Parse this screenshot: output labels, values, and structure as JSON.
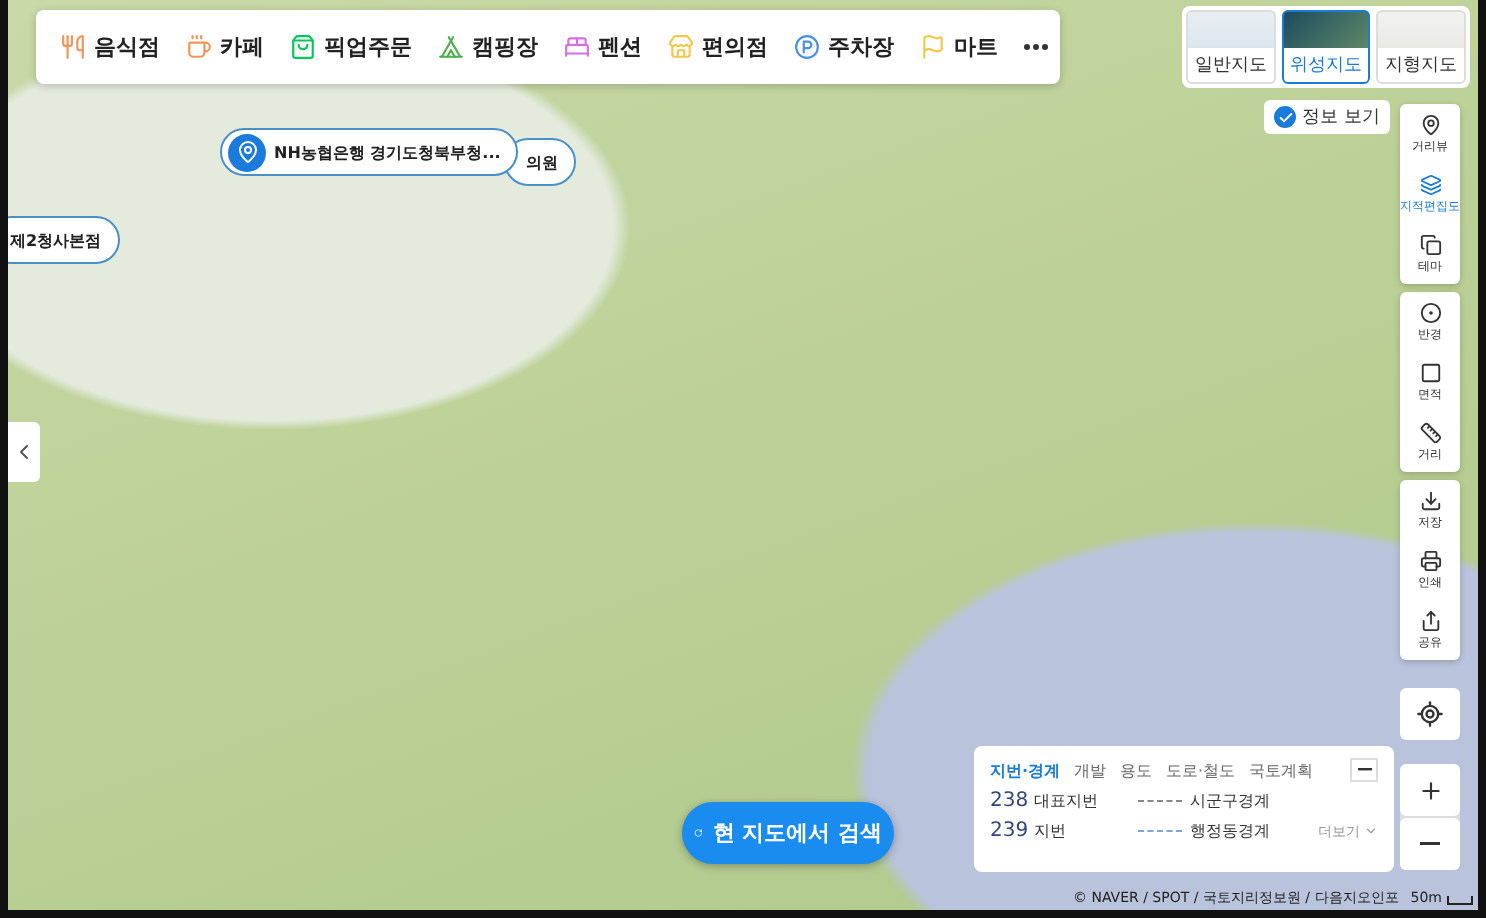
{
  "categories": [
    {
      "kind": "food",
      "label": "음식점",
      "color": "#f0955a"
    },
    {
      "kind": "cafe",
      "label": "카페",
      "color": "#f0955a"
    },
    {
      "kind": "pickup",
      "label": "픽업주문",
      "color": "#03c75a"
    },
    {
      "kind": "camping",
      "label": "캠핑장",
      "color": "#4caf50"
    },
    {
      "kind": "pension",
      "label": "펜션",
      "color": "#d76fe0"
    },
    {
      "kind": "store",
      "label": "편의점",
      "color": "#f2c94c"
    },
    {
      "kind": "parking",
      "label": "주차장",
      "color": "#4a90e2"
    },
    {
      "kind": "mart",
      "label": "마트",
      "color": "#f2c94c"
    }
  ],
  "map_types": [
    {
      "kind": "normal",
      "label": "일반지도",
      "selected": false
    },
    {
      "kind": "satellite",
      "label": "위성지도",
      "selected": true
    },
    {
      "kind": "terrain",
      "label": "지형지도",
      "selected": false
    }
  ],
  "info_toggle": {
    "label": "정보 보기",
    "checked": true
  },
  "pins": [
    {
      "label": "NH농협은행 경기도청북부청..."
    },
    {
      "label": "의원"
    },
    {
      "label": "제2청사본점"
    }
  ],
  "toolbar_groups": [
    [
      {
        "kind": "streetview",
        "label": "거리뷰",
        "selected": false
      },
      {
        "kind": "cadastral",
        "label": "지적편집도",
        "selected": true
      },
      {
        "kind": "theme",
        "label": "테마",
        "selected": false
      }
    ],
    [
      {
        "kind": "radius",
        "label": "반경",
        "selected": false
      },
      {
        "kind": "area",
        "label": "면적",
        "selected": false
      },
      {
        "kind": "distance",
        "label": "거리",
        "selected": false
      }
    ],
    [
      {
        "kind": "save",
        "label": "저장",
        "selected": false
      },
      {
        "kind": "print",
        "label": "인쇄",
        "selected": false
      },
      {
        "kind": "share",
        "label": "공유",
        "selected": false
      }
    ]
  ],
  "search_button": "현 지도에서 검색",
  "legend": {
    "tabs": [
      {
        "label": "지번·경계",
        "selected": true
      },
      {
        "label": "개발",
        "selected": false
      },
      {
        "label": "용도",
        "selected": false
      },
      {
        "label": "도로·철도",
        "selected": false
      },
      {
        "label": "국토계획",
        "selected": false
      }
    ],
    "rows": [
      {
        "number": "238",
        "label": "대표지번",
        "line_label": "시군구경계",
        "color": "#888888"
      },
      {
        "number": "239",
        "label": "지번",
        "line_label": "행정동경계",
        "color": "#7fa6d8"
      }
    ],
    "more": "더보기"
  },
  "attribution": "© NAVER / SPOT / 국토지리정보원 / 다음지오인포",
  "scale": "50m"
}
